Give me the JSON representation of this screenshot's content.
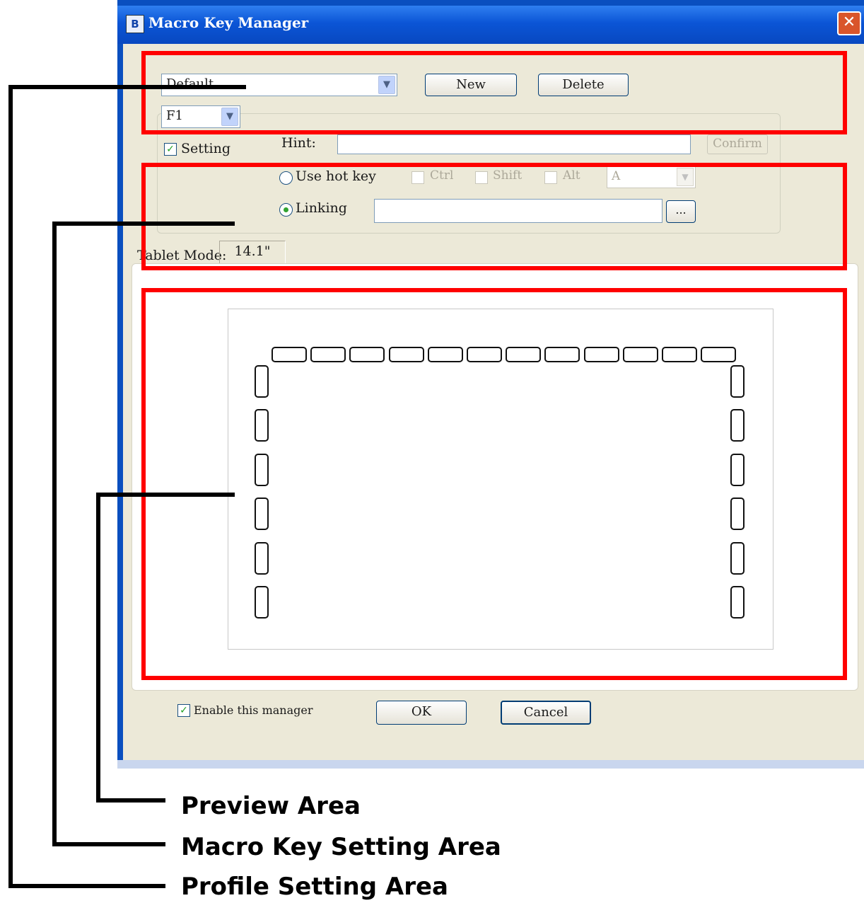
{
  "window": {
    "title": "Macro Key Manager",
    "icon_glyph": "B",
    "close_glyph": "✕"
  },
  "profile": {
    "selected": "Default",
    "new_label": "New",
    "delete_label": "Delete"
  },
  "macro": {
    "key_selected": "F1",
    "setting_label": "Setting",
    "setting_checked": true,
    "hint_label": "Hint:",
    "hint_value": "",
    "confirm_label": "Confirm",
    "use_hotkey_label": "Use hot key",
    "ctrl_label": "Ctrl",
    "shift_label": "Shift",
    "alt_label": "Alt",
    "hotkey_value": "A",
    "linking_label": "Linking",
    "linking_value": "",
    "browse_label": "..."
  },
  "tablet": {
    "mode_label": "Tablet Mode:",
    "size": "14.1\""
  },
  "preview": {
    "top_keys": 12,
    "left_keys": 6,
    "right_keys": 6
  },
  "footer": {
    "enable_label": "Enable this manager",
    "enable_checked": true,
    "ok_label": "OK",
    "cancel_label": "Cancel"
  },
  "annotations": {
    "preview_area": "Preview Area",
    "macro_key_setting_area": "Macro Key Setting Area",
    "profile_setting_area": "Profile Setting Area"
  },
  "colors": {
    "title_bar": "#0b55d6",
    "dialog_bg": "#ece9d8",
    "highlight_red": "#ff0000",
    "check_green": "#21a121"
  }
}
